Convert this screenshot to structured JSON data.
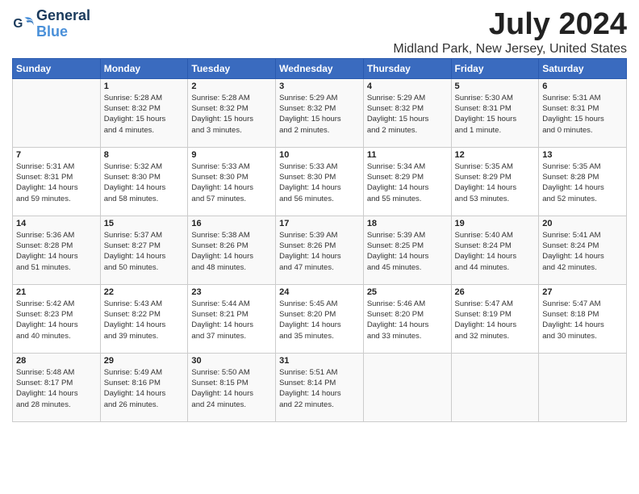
{
  "logo": {
    "line1": "General",
    "line2": "Blue"
  },
  "title": "July 2024",
  "location": "Midland Park, New Jersey, United States",
  "days_of_week": [
    "Sunday",
    "Monday",
    "Tuesday",
    "Wednesday",
    "Thursday",
    "Friday",
    "Saturday"
  ],
  "weeks": [
    [
      {
        "day": "",
        "content": ""
      },
      {
        "day": "1",
        "content": "Sunrise: 5:28 AM\nSunset: 8:32 PM\nDaylight: 15 hours\nand 4 minutes."
      },
      {
        "day": "2",
        "content": "Sunrise: 5:28 AM\nSunset: 8:32 PM\nDaylight: 15 hours\nand 3 minutes."
      },
      {
        "day": "3",
        "content": "Sunrise: 5:29 AM\nSunset: 8:32 PM\nDaylight: 15 hours\nand 2 minutes."
      },
      {
        "day": "4",
        "content": "Sunrise: 5:29 AM\nSunset: 8:32 PM\nDaylight: 15 hours\nand 2 minutes."
      },
      {
        "day": "5",
        "content": "Sunrise: 5:30 AM\nSunset: 8:31 PM\nDaylight: 15 hours\nand 1 minute."
      },
      {
        "day": "6",
        "content": "Sunrise: 5:31 AM\nSunset: 8:31 PM\nDaylight: 15 hours\nand 0 minutes."
      }
    ],
    [
      {
        "day": "7",
        "content": "Sunrise: 5:31 AM\nSunset: 8:31 PM\nDaylight: 14 hours\nand 59 minutes."
      },
      {
        "day": "8",
        "content": "Sunrise: 5:32 AM\nSunset: 8:30 PM\nDaylight: 14 hours\nand 58 minutes."
      },
      {
        "day": "9",
        "content": "Sunrise: 5:33 AM\nSunset: 8:30 PM\nDaylight: 14 hours\nand 57 minutes."
      },
      {
        "day": "10",
        "content": "Sunrise: 5:33 AM\nSunset: 8:30 PM\nDaylight: 14 hours\nand 56 minutes."
      },
      {
        "day": "11",
        "content": "Sunrise: 5:34 AM\nSunset: 8:29 PM\nDaylight: 14 hours\nand 55 minutes."
      },
      {
        "day": "12",
        "content": "Sunrise: 5:35 AM\nSunset: 8:29 PM\nDaylight: 14 hours\nand 53 minutes."
      },
      {
        "day": "13",
        "content": "Sunrise: 5:35 AM\nSunset: 8:28 PM\nDaylight: 14 hours\nand 52 minutes."
      }
    ],
    [
      {
        "day": "14",
        "content": "Sunrise: 5:36 AM\nSunset: 8:28 PM\nDaylight: 14 hours\nand 51 minutes."
      },
      {
        "day": "15",
        "content": "Sunrise: 5:37 AM\nSunset: 8:27 PM\nDaylight: 14 hours\nand 50 minutes."
      },
      {
        "day": "16",
        "content": "Sunrise: 5:38 AM\nSunset: 8:26 PM\nDaylight: 14 hours\nand 48 minutes."
      },
      {
        "day": "17",
        "content": "Sunrise: 5:39 AM\nSunset: 8:26 PM\nDaylight: 14 hours\nand 47 minutes."
      },
      {
        "day": "18",
        "content": "Sunrise: 5:39 AM\nSunset: 8:25 PM\nDaylight: 14 hours\nand 45 minutes."
      },
      {
        "day": "19",
        "content": "Sunrise: 5:40 AM\nSunset: 8:24 PM\nDaylight: 14 hours\nand 44 minutes."
      },
      {
        "day": "20",
        "content": "Sunrise: 5:41 AM\nSunset: 8:24 PM\nDaylight: 14 hours\nand 42 minutes."
      }
    ],
    [
      {
        "day": "21",
        "content": "Sunrise: 5:42 AM\nSunset: 8:23 PM\nDaylight: 14 hours\nand 40 minutes."
      },
      {
        "day": "22",
        "content": "Sunrise: 5:43 AM\nSunset: 8:22 PM\nDaylight: 14 hours\nand 39 minutes."
      },
      {
        "day": "23",
        "content": "Sunrise: 5:44 AM\nSunset: 8:21 PM\nDaylight: 14 hours\nand 37 minutes."
      },
      {
        "day": "24",
        "content": "Sunrise: 5:45 AM\nSunset: 8:20 PM\nDaylight: 14 hours\nand 35 minutes."
      },
      {
        "day": "25",
        "content": "Sunrise: 5:46 AM\nSunset: 8:20 PM\nDaylight: 14 hours\nand 33 minutes."
      },
      {
        "day": "26",
        "content": "Sunrise: 5:47 AM\nSunset: 8:19 PM\nDaylight: 14 hours\nand 32 minutes."
      },
      {
        "day": "27",
        "content": "Sunrise: 5:47 AM\nSunset: 8:18 PM\nDaylight: 14 hours\nand 30 minutes."
      }
    ],
    [
      {
        "day": "28",
        "content": "Sunrise: 5:48 AM\nSunset: 8:17 PM\nDaylight: 14 hours\nand 28 minutes."
      },
      {
        "day": "29",
        "content": "Sunrise: 5:49 AM\nSunset: 8:16 PM\nDaylight: 14 hours\nand 26 minutes."
      },
      {
        "day": "30",
        "content": "Sunrise: 5:50 AM\nSunset: 8:15 PM\nDaylight: 14 hours\nand 24 minutes."
      },
      {
        "day": "31",
        "content": "Sunrise: 5:51 AM\nSunset: 8:14 PM\nDaylight: 14 hours\nand 22 minutes."
      },
      {
        "day": "",
        "content": ""
      },
      {
        "day": "",
        "content": ""
      },
      {
        "day": "",
        "content": ""
      }
    ]
  ]
}
